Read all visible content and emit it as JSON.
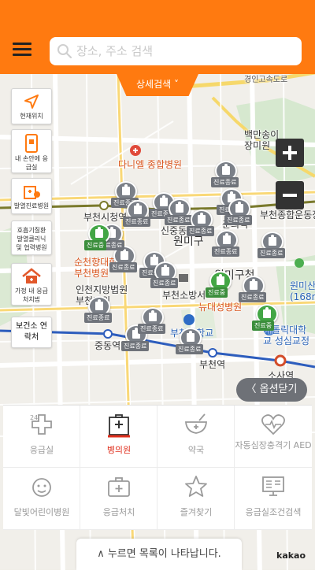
{
  "header": {
    "search_placeholder": "장소, 주소 검색",
    "detail_search_label": "상세검색 ˅",
    "accent_color": "#ff7a10"
  },
  "side_buttons": [
    {
      "id": "current-location",
      "label": "현재위치",
      "icon": "location-arrow-icon"
    },
    {
      "id": "in-hand-emergency",
      "label": "내 손안에 응급실",
      "icon": "phone-icon"
    },
    {
      "id": "resp-clinic",
      "label": "발열진료병원",
      "icon": "hospital-building-icon"
    },
    {
      "id": "resp-care",
      "label": "호흡기질환 발열클리닉 및 협력병원",
      "icon": "none"
    },
    {
      "id": "home-care",
      "label": "가정 내 응급처치법",
      "icon": "home-icon"
    },
    {
      "id": "health-center",
      "label": "보건소 연락처",
      "icon": "none"
    }
  ],
  "map": {
    "labels": [
      {
        "text": "다니엘 종합병원",
        "style": "red"
      },
      {
        "text": "부천시청역",
        "style": "normal"
      },
      {
        "text": "신중동역",
        "style": "normal"
      },
      {
        "text": "원미구",
        "style": "big"
      },
      {
        "text": "춘의역",
        "style": "normal"
      },
      {
        "text": "부천종합운동장역",
        "style": "normal"
      },
      {
        "text": "순천향대학교 부천병원",
        "style": "red"
      },
      {
        "text": "원미구청",
        "style": "big"
      },
      {
        "text": "인천지방법원 부천지원",
        "style": "normal"
      },
      {
        "text": "부천소방서",
        "style": "normal"
      },
      {
        "text": "뉴대성병원",
        "style": "red"
      },
      {
        "text": "원미산 (168m)",
        "style": "blue"
      },
      {
        "text": "부천대학교",
        "style": "blue"
      },
      {
        "text": "가톨릭대학교 성심교정",
        "style": "blue"
      },
      {
        "text": "중동역",
        "style": "normal"
      },
      {
        "text": "부천역",
        "style": "normal"
      },
      {
        "text": "소사역",
        "style": "normal"
      },
      {
        "text": "백만송이 장미원",
        "style": "normal"
      },
      {
        "text": "경인고속도로",
        "style": "small"
      }
    ],
    "pins": [
      {
        "tag": "진료종료",
        "green": false
      },
      {
        "tag": "진료종료",
        "green": false
      },
      {
        "tag": "진료종료",
        "green": false
      },
      {
        "tag": "진료종료",
        "green": false
      },
      {
        "tag": "진료종료",
        "green": false
      },
      {
        "tag": "진료종료",
        "green": false
      },
      {
        "tag": "진료종료",
        "green": false
      },
      {
        "tag": "진료종료",
        "green": false
      },
      {
        "tag": "진료종료",
        "green": false
      },
      {
        "tag": "진료종료",
        "green": false
      },
      {
        "tag": "진료종료",
        "green": false
      },
      {
        "tag": "진료종료",
        "green": false
      },
      {
        "tag": "진료종료",
        "green": false
      },
      {
        "tag": "진료종료",
        "green": false
      },
      {
        "tag": "진료종료",
        "green": false
      },
      {
        "tag": "진료종료",
        "green": false
      },
      {
        "tag": "진료종료",
        "green": false
      },
      {
        "tag": "진료종료",
        "green": false
      },
      {
        "tag": "진료종료",
        "green": false
      },
      {
        "tag": "진료중",
        "green": true
      },
      {
        "tag": "진료중",
        "green": true
      },
      {
        "tag": "진료중",
        "green": true
      }
    ],
    "zoom_in_label": "+",
    "zoom_out_label": "−",
    "options_close_label": "〈 옵션닫기"
  },
  "categories": [
    {
      "label": "응급실",
      "icon": "emergency-24-icon",
      "active": false
    },
    {
      "label": "병의원",
      "icon": "hospital-icon",
      "active": true
    },
    {
      "label": "약국",
      "icon": "pharmacy-bowl-icon",
      "active": false
    },
    {
      "label": "자동심장충격기 AED",
      "icon": "heart-pulse-icon",
      "active": false
    },
    {
      "label": "달빛어린이병원",
      "icon": "moon-child-icon",
      "active": false
    },
    {
      "label": "응급처치",
      "icon": "first-aid-kit-icon",
      "active": false
    },
    {
      "label": "즐겨찾기",
      "icon": "star-icon",
      "active": false
    },
    {
      "label": "응급실조건검색",
      "icon": "monitor-list-icon",
      "active": false
    }
  ],
  "footer": {
    "list_toggle_label": "∧ 누르면 목록이 나타납니다.",
    "map_provider": "kakao"
  }
}
